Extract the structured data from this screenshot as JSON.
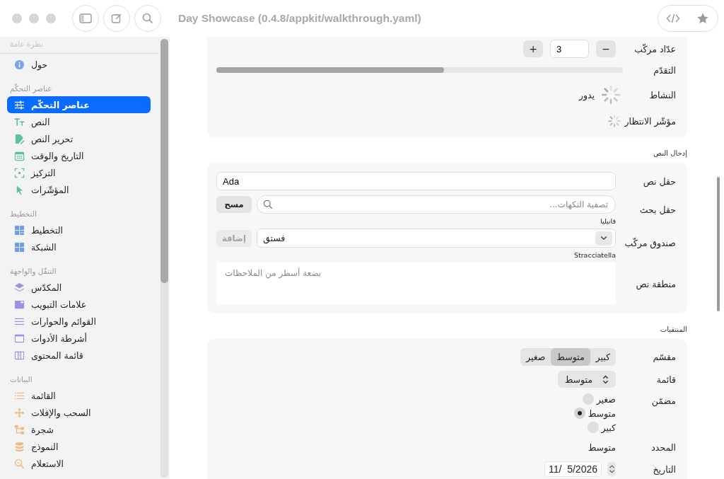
{
  "window": {
    "title": "Day Showcase (0.4.8/appkit/walkthrough.yaml)"
  },
  "sidebar": {
    "sections": [
      {
        "title": "نظرة عامة",
        "items": [
          {
            "label": "حول",
            "selected": false
          }
        ]
      },
      {
        "title": "عناصر التحكّم",
        "items": [
          {
            "label": "عناصر التحكّم",
            "selected": true
          },
          {
            "label": "النص",
            "selected": false
          },
          {
            "label": "تحرير النص",
            "selected": false
          },
          {
            "label": "التاريخ والوقت",
            "selected": false
          },
          {
            "label": "التركيز",
            "selected": false
          },
          {
            "label": "المؤشّرات",
            "selected": false
          }
        ]
      },
      {
        "title": "التخطيط",
        "items": [
          {
            "label": "التخطيط",
            "selected": false
          },
          {
            "label": "الشبكة",
            "selected": false
          }
        ]
      },
      {
        "title": "التنقّل والواجهة",
        "items": [
          {
            "label": "المكدّس",
            "selected": false
          },
          {
            "label": "علامات التبويب",
            "selected": false
          },
          {
            "label": "القوائم والحوارات",
            "selected": false
          },
          {
            "label": "أشرطة الأدوات",
            "selected": false
          },
          {
            "label": "قائمة المحتوى",
            "selected": false
          }
        ]
      },
      {
        "title": "البيانات",
        "items": [
          {
            "label": "القائمة",
            "selected": false
          },
          {
            "label": "السحب والإفلات",
            "selected": false
          },
          {
            "label": "شجرة",
            "selected": false
          },
          {
            "label": "النموذج",
            "selected": false
          },
          {
            "label": "الاستعلام",
            "selected": false
          }
        ]
      }
    ]
  },
  "main": {
    "groups": [
      {
        "rows": [
          {
            "kind": "stepper",
            "label": "عدّاد مركّب",
            "decrement": "−",
            "value": "3",
            "increment": "+"
          },
          {
            "kind": "progress",
            "label": "التقدّم",
            "level": 0.56
          },
          {
            "kind": "activity",
            "label": "النشاط",
            "text": "يدور"
          },
          {
            "kind": "waiting",
            "label": "مؤشّر الانتظار"
          }
        ]
      },
      {
        "title": "إدخال النص",
        "rows": [
          {
            "kind": "text_field",
            "label": "حقل نص",
            "value": "Ada"
          },
          {
            "kind": "search_field",
            "label": "حقل بحث",
            "placeholder": "تصفية النكهات...",
            "button": "مسح",
            "note": "فانيليا"
          },
          {
            "kind": "combo_box",
            "label": "صندوق مركّب",
            "value": "فستق",
            "button": "إضافة",
            "disabled": true,
            "note": "Stracciatella"
          },
          {
            "kind": "text_area",
            "label": "منطقة نص",
            "placeholder": "بضعة أسطر من الملاحظات"
          }
        ]
      },
      {
        "title": "المنتقيات",
        "rows": [
          {
            "kind": "segmented",
            "label": "مقسّم",
            "options": [
              {
                "label": "كبير",
                "selected": false
              },
              {
                "label": "متوسط",
                "selected": true
              },
              {
                "label": "صغير",
                "selected": false
              }
            ]
          },
          {
            "kind": "popup",
            "label": "قائمة",
            "value": "متوسط"
          },
          {
            "kind": "radio",
            "label": "مضمّن",
            "options": [
              {
                "label": "صغير",
                "selected": false
              },
              {
                "label": "متوسط",
                "selected": true
              },
              {
                "label": "كبير",
                "selected": false
              }
            ]
          },
          {
            "kind": "value",
            "label": "المحدد",
            "value": "متوسط"
          },
          {
            "kind": "date",
            "label": "التاريخ",
            "value": "11/  5/2026"
          }
        ]
      }
    ]
  }
}
